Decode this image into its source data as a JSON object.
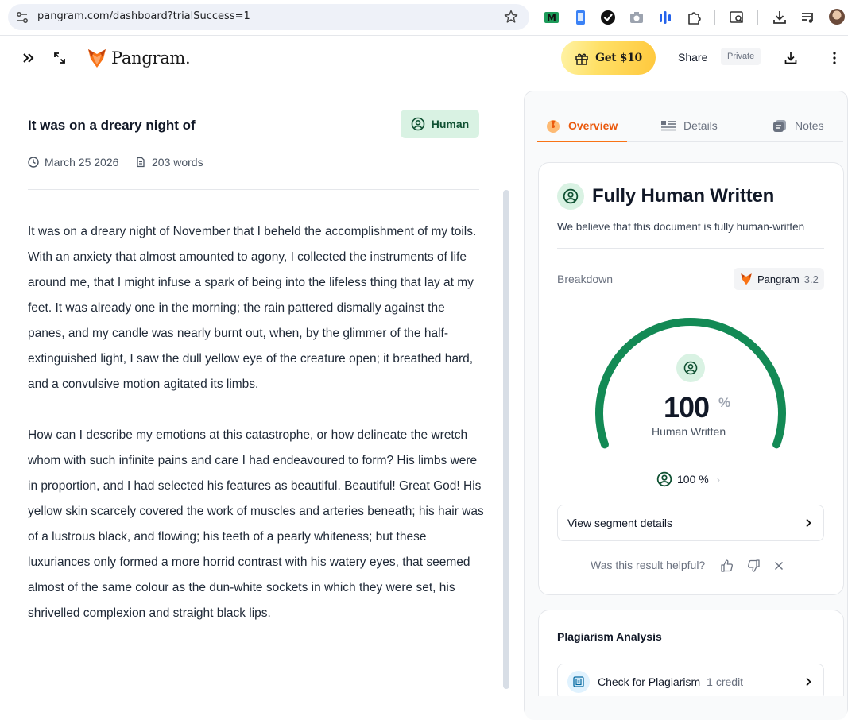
{
  "browser": {
    "url": "pangram.com/dashboard?trialSuccess=1",
    "extensions": [
      "mail-extension-icon",
      "phone-extension-icon",
      "check-extension-icon",
      "camera-extension-icon",
      "bars-extension-icon",
      "puzzle-extensions-icon",
      "tab-search-icon",
      "download-icon",
      "media-control-icon",
      "profile-avatar"
    ]
  },
  "header": {
    "brand": "Pangram.",
    "promo_label": "Get $10",
    "share_label": "Share",
    "visibility_label": "Private"
  },
  "document": {
    "title": "It was on a dreary night of",
    "tag": "Human",
    "date": "March 25 2026",
    "word_count": "203 words",
    "paragraphs": [
      "It was on a dreary night of November that I beheld the accomplishment of my toils. With an anxiety that almost amounted to agony, I collected the instruments of life around me, that I might infuse a spark of being into the lifeless thing that lay at my feet. It was already one in the morning; the rain pattered dismally against the panes, and my candle was nearly burnt out, when, by the glimmer of the half-extinguished light, I saw the dull yellow eye of the creature open; it breathed hard, and a convulsive motion agitated its limbs.",
      "How can I describe my emotions at this catastrophe, or how delineate the wretch whom with such infinite pains and care I had endeavoured to form? His limbs were in proportion, and I had selected his features as beautiful. Beautiful! Great God! His yellow skin scarcely covered the work of muscles and arteries beneath; his hair was of a lustrous black, and flowing; his teeth of a pearly whiteness; but these luxuriances only formed a more horrid contrast with his watery eyes, that seemed almost of the same colour as the dun-white sockets in which they were set, his shrivelled complexion and straight black lips."
    ]
  },
  "panel": {
    "tabs": [
      {
        "label": "Overview",
        "active": true
      },
      {
        "label": "Details",
        "active": false
      },
      {
        "label": "Notes",
        "active": false
      }
    ],
    "result": {
      "title": "Fully Human Written",
      "subtitle": "We believe that this document is fully human-written",
      "breakdown_label": "Breakdown",
      "model_name": "Pangram",
      "model_version": "3.2",
      "gauge_value": "100",
      "gauge_fraction": 1.0,
      "gauge_unit": "%",
      "gauge_label": "Human Written",
      "summary_value": "100 %",
      "segment_button": "View segment details",
      "helpful_prompt": "Was this result helpful?"
    },
    "plagiarism": {
      "title": "Plagiarism Analysis",
      "button_label": "Check for Plagiarism",
      "credit_label": "1 credit"
    }
  },
  "colors": {
    "accent_orange": "#ea580c",
    "human_green": "#138a55",
    "human_bg": "#d9f2e3",
    "promo_yellow": "#ffd84d"
  }
}
